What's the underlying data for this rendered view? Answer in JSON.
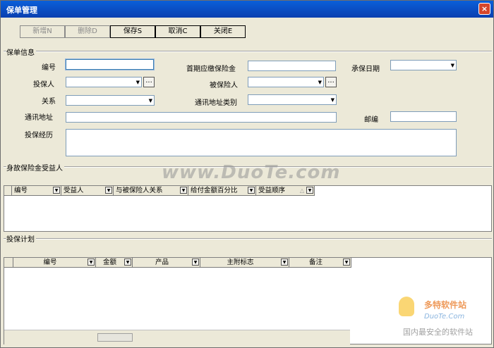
{
  "window": {
    "title": "保单管理",
    "close_glyph": "×"
  },
  "toolbar": {
    "new_label": "新增N",
    "delete_label": "删除D",
    "save_label": "保存S",
    "cancel_label": "取消C",
    "close_label": "关闭E"
  },
  "policy_info": {
    "group_title": "保单信息",
    "number_label": "编号",
    "first_premium_label": "首期应缴保险金",
    "underwrite_date_label": "承保日期",
    "policyholder_label": "投保人",
    "insured_label": "被保险人",
    "relation_label": "关系",
    "address_type_label": "通讯地址类别",
    "address_label": "通讯地址",
    "zip_label": "邮编",
    "history_label": "投保经历",
    "number_value": "",
    "first_premium_value": "",
    "address_value": "",
    "zip_value": "",
    "ellipsis": "..."
  },
  "beneficiary": {
    "group_title": "身故保险金受益人",
    "columns": [
      "编号",
      "受益人",
      "与被保险人关系",
      "给付金额百分比",
      "受益顺序"
    ],
    "sort_glyph": "△"
  },
  "plan": {
    "group_title": "投保计划",
    "columns": [
      "编号",
      "金额",
      "产品",
      "主附标志",
      "备注"
    ]
  },
  "watermarks": {
    "main": "www.DuoTe.com",
    "brand": "多特软件站",
    "brand_url": "DuoTe.Com",
    "slogan": "国内最安全的软件站"
  },
  "colors": {
    "titlebar": "#0a4fc6",
    "background": "#ece9d8",
    "disabled_text": "#8a8a8a"
  }
}
